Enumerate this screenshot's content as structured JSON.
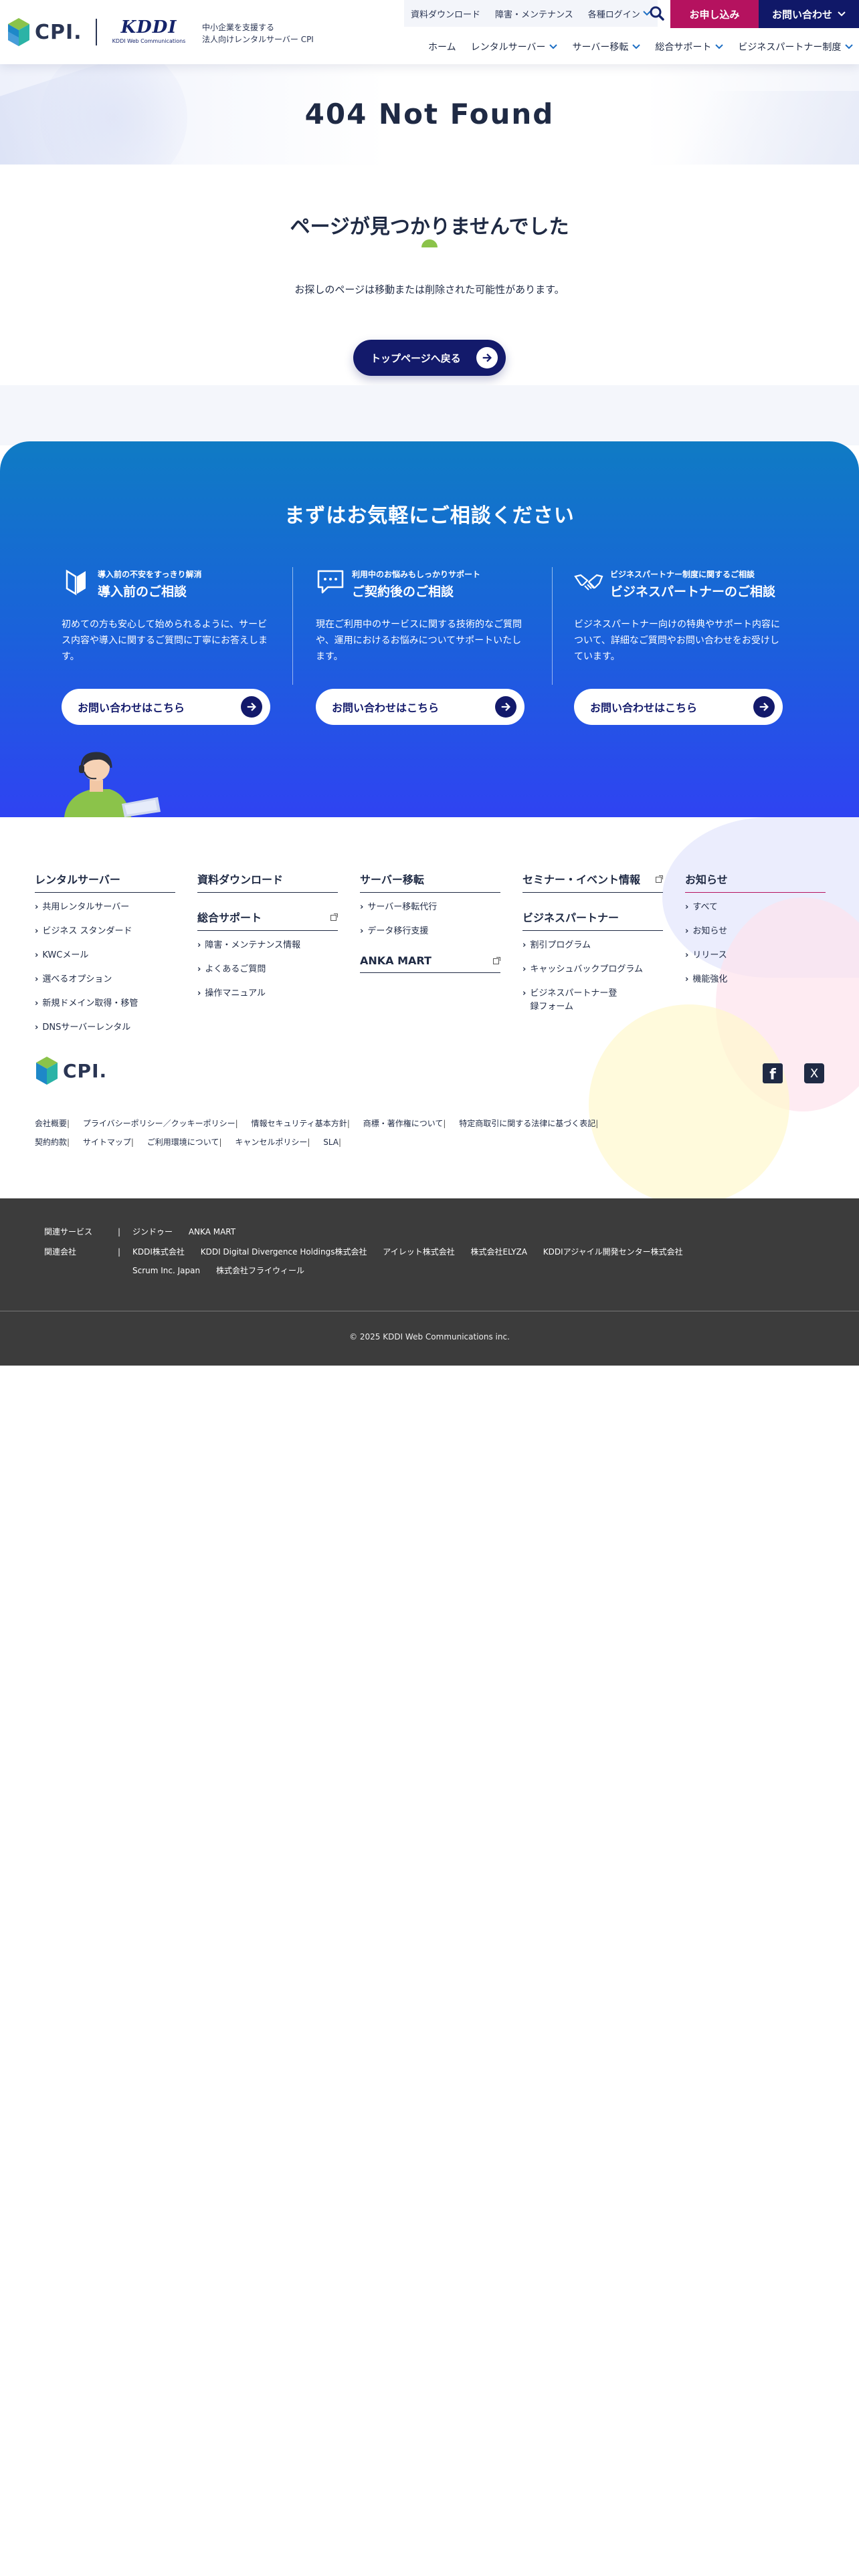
{
  "header": {
    "tagline_line1": "中小企業を支援する",
    "tagline_line2": "法人向けレンタルサーバー CPI",
    "kddi_logo": "KDDI",
    "kddi_sub": "KDDI Web Communications",
    "cpi_logo": "CPI.",
    "util_links": [
      "資料ダウンロード",
      "障害・メンテナンス",
      "各種ログイン"
    ],
    "apply_label": "お申し込み",
    "contact_label": "お問い合わせ",
    "nav": [
      "ホーム",
      "レンタルサーバー",
      "サーバー移転",
      "総合サポート",
      "ビジネスパートナー制度"
    ]
  },
  "hero": {
    "title": "404 Not Found"
  },
  "notfound": {
    "heading": "ページが見つかりませんでした",
    "message": "お探しのページは移動または削除された可能性があります。",
    "button": "トップページへ戻る"
  },
  "consult": {
    "title": "まずはお気軽にご相談ください",
    "cards": [
      {
        "kicker": "導入前の不安をすっきり解消",
        "title": "導入前のご相談",
        "desc": "初めての方も安心して始められるように、サービス内容や導入に関するご質問に丁寧にお答えします。",
        "button": "お問い合わせはこちら"
      },
      {
        "kicker": "利用中のお悩みもしっかりサポート",
        "title": "ご契約後のご相談",
        "desc": "現在ご利用中のサービスに関する技術的なご質問や、運用におけるお悩みについてサポートいたします。",
        "button": "お問い合わせはこちら"
      },
      {
        "kicker": "ビジネスパートナー制度に関するご相談",
        "title": "ビジネスパートナーのご相談",
        "desc": "ビジネスパートナー向けの特典やサポート内容について、詳細なご質問やお問い合わせをお受けしています。",
        "button": "お問い合わせはこちら"
      }
    ]
  },
  "footer_nav": {
    "col1": {
      "head": "レンタルサーバー",
      "links": [
        "共用レンタルサーバー",
        "ビジネス スタンダード",
        "KWCメール",
        "選べるオプション",
        "新規ドメイン取得・移管",
        "DNSサーバーレンタル"
      ]
    },
    "col2": {
      "head": "資料ダウンロード",
      "sub_head": "総合サポート",
      "links": [
        "障害・メンテナンス情報",
        "よくあるご質問",
        "操作マニュアル"
      ]
    },
    "col3": {
      "head": "サーバー移転",
      "links": [
        "サーバー移転代行",
        "データ移行支援"
      ],
      "sub_head": "ANKA MART"
    },
    "col4": {
      "head": "セミナー・イベント情報",
      "sub_head": "ビジネスパートナー",
      "links": [
        "割引プログラム",
        "キャッシュバックプログラム",
        "ビジネスパートナー登録フォーム"
      ]
    },
    "col5": {
      "head": "お知らせ",
      "links": [
        "すべて",
        "お知らせ",
        "リリース",
        "機能強化"
      ]
    },
    "logo": "CPI.",
    "sns": {
      "facebook": "f",
      "x": "X"
    },
    "legal_row1": [
      "会社概要",
      "プライバシーポリシー／クッキーポリシー",
      "情報セキュリティ基本方針",
      "商標・著作権について",
      "特定商取引に関する法律に基づく表記"
    ],
    "legal_row2": [
      "契約約款",
      "サイトマップ",
      "ご利用環境について",
      "キャンセルポリシー",
      "SLA"
    ]
  },
  "dark_footer": {
    "services_label": "関連サービス",
    "services": [
      "ジンドゥー",
      "ANKA MART"
    ],
    "companies_label": "関連会社",
    "companies_row1": [
      "KDDI株式会社",
      "KDDI Digital Divergence Holdings株式会社",
      "アイレット株式会社",
      "株式会社ELYZA",
      "KDDIアジャイル開発センター株式会社"
    ],
    "companies_row2": [
      "Scrum Inc. Japan",
      "株式会社フライウィール"
    ],
    "copyright": "© 2025 KDDI Web Communications inc."
  },
  "colors": {
    "navy": "#131a6b",
    "magenta": "#b5125f",
    "consult_top": "#0f7bc4",
    "consult_bottom": "#2f43f2",
    "dark_footer": "#3c3c3c",
    "accent_green": "#8bc34a"
  }
}
